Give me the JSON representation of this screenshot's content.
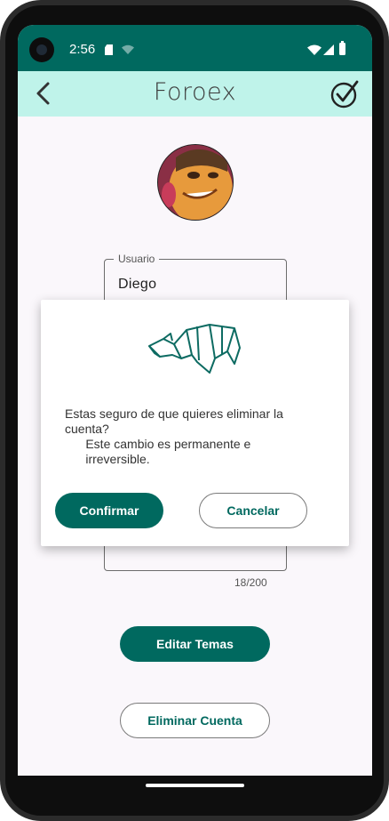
{
  "status_bar": {
    "time": "2:56"
  },
  "app_bar": {
    "title": "Foroex"
  },
  "profile": {
    "username_label": "Usuario",
    "username_value": "Diego",
    "description_counter": "18/200"
  },
  "buttons": {
    "edit_topics": "Editar Temas",
    "delete_account": "Eliminar Cuenta"
  },
  "dialog": {
    "message_line1": "Estas seguro de que quieres eliminar la",
    "message_line2": "cuenta?",
    "message_line3": "      Este cambio es permanente e",
    "message_line4": "      irreversible.",
    "confirm_label": "Confirmar",
    "cancel_label": "Cancelar"
  },
  "colors": {
    "primary": "#00695f",
    "app_bar": "#bff3ea",
    "background": "#faf7fb"
  },
  "icons": [
    "sd-card-icon",
    "wifi-off-icon",
    "wifi-icon",
    "signal-icon",
    "battery-icon",
    "back-arrow-icon",
    "check-circle-icon",
    "rhino-logo-icon"
  ]
}
